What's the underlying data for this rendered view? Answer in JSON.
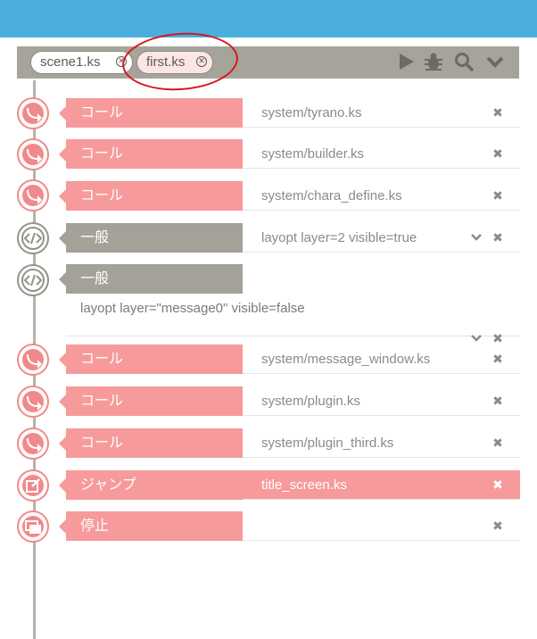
{
  "tabs": [
    {
      "label": "scene1.ks"
    },
    {
      "label": "first.ks"
    }
  ],
  "toolbar": {
    "icons": [
      "play-icon",
      "bug-icon",
      "search-icon",
      "chevron-down-icon"
    ]
  },
  "annotation": {
    "color": "#d8161d"
  },
  "colors": {
    "top_bar": "#49aede",
    "call": "#f79a9b",
    "general": "#a4a198"
  },
  "rows": [
    {
      "type": "call",
      "label": "コール",
      "value": "system/tyrano.ks"
    },
    {
      "type": "call",
      "label": "コール",
      "value": "system/builder.ks"
    },
    {
      "type": "call",
      "label": "コール",
      "value": "system/chara_define.ks"
    },
    {
      "type": "gen",
      "label": "一般",
      "value": "layopt layer=2 visible=true"
    },
    {
      "type": "gen",
      "label": "一般",
      "value": "layopt layer=\"message0\" visible=false"
    },
    {
      "type": "call",
      "label": "コール",
      "value": "system/message_window.ks"
    },
    {
      "type": "call",
      "label": "コール",
      "value": "system/plugin.ks"
    },
    {
      "type": "call",
      "label": "コール",
      "value": "system/plugin_third.ks"
    },
    {
      "type": "jump",
      "label": "ジャンプ",
      "value": "title_screen.ks"
    },
    {
      "type": "stop",
      "label": "停止",
      "value": ""
    }
  ],
  "delete_glyph": "✖",
  "tab_close_glyph": "✕"
}
